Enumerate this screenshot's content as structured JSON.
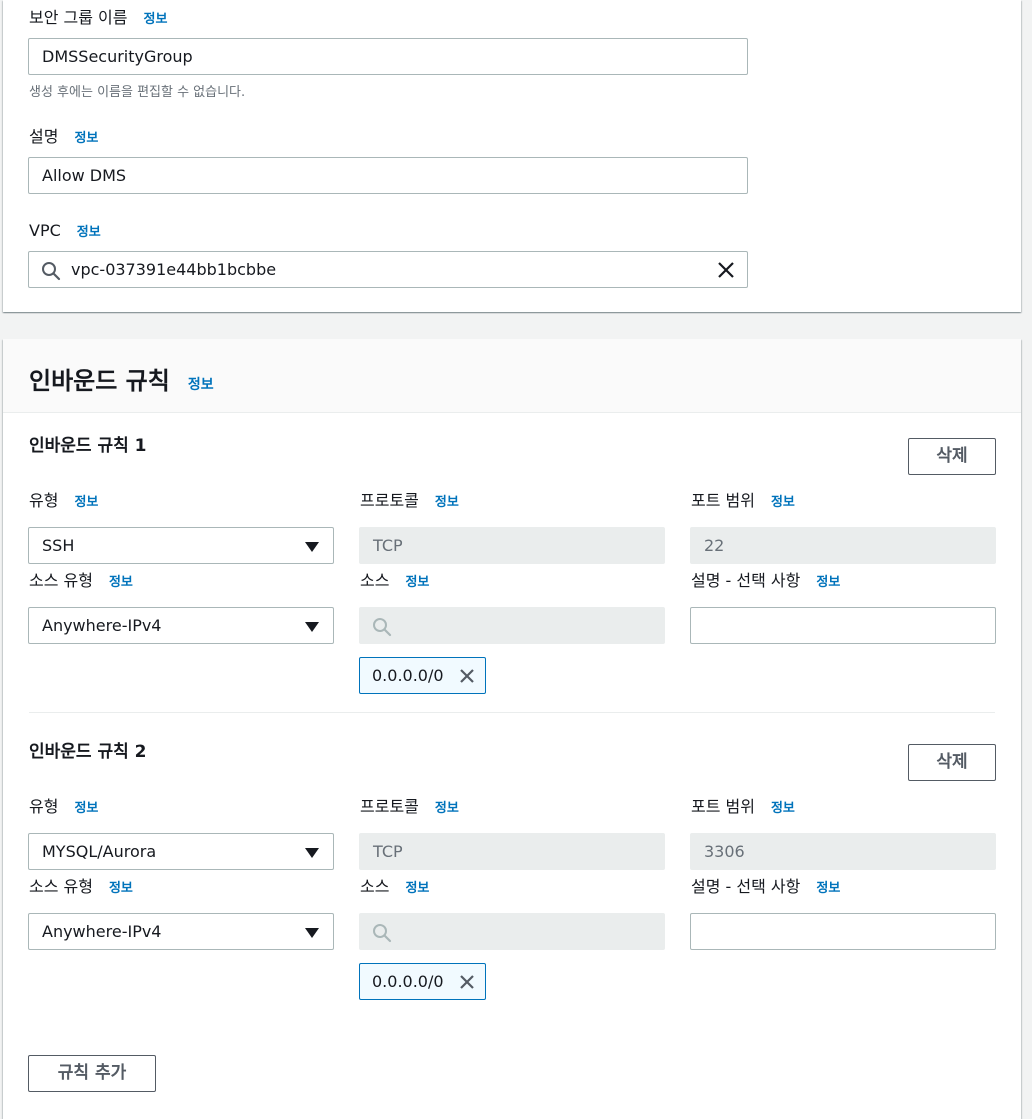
{
  "info_label": "정보",
  "basic": {
    "name_label": "보안 그룹 이름",
    "name_value": "DMSSecurityGroup",
    "name_hint": "생성 후에는 이름을 편집할 수 없습니다.",
    "desc_label": "설명",
    "desc_value": "Allow DMS",
    "vpc_label": "VPC",
    "vpc_value": "vpc-037391e44bb1bcbbe"
  },
  "inbound": {
    "title": "인바운드 규칙",
    "add_rule_label": "규칙 추가",
    "rules": [
      {
        "title": "인바운드 규칙 1",
        "delete_label": "삭제",
        "type_label": "유형",
        "type_value": "SSH",
        "protocol_label": "프로토콜",
        "protocol_value": "TCP",
        "port_label": "포트 범위",
        "port_value": "22",
        "source_type_label": "소스 유형",
        "source_type_value": "Anywhere-IPv4",
        "source_label": "소스",
        "source_token": "0.0.0.0/0",
        "desc_label": "설명 - 선택 사항"
      },
      {
        "title": "인바운드 규칙 2",
        "delete_label": "삭제",
        "type_label": "유형",
        "type_value": "MYSQL/Aurora",
        "protocol_label": "프로토콜",
        "protocol_value": "TCP",
        "port_label": "포트 범위",
        "port_value": "3306",
        "source_type_label": "소스 유형",
        "source_type_value": "Anywhere-IPv4",
        "source_label": "소스",
        "source_token": "0.0.0.0/0",
        "desc_label": "설명 - 선택 사항"
      }
    ]
  },
  "colors": {
    "link": "#0073bb",
    "border": "#aab7b8",
    "disabled_bg": "#eaeded"
  }
}
